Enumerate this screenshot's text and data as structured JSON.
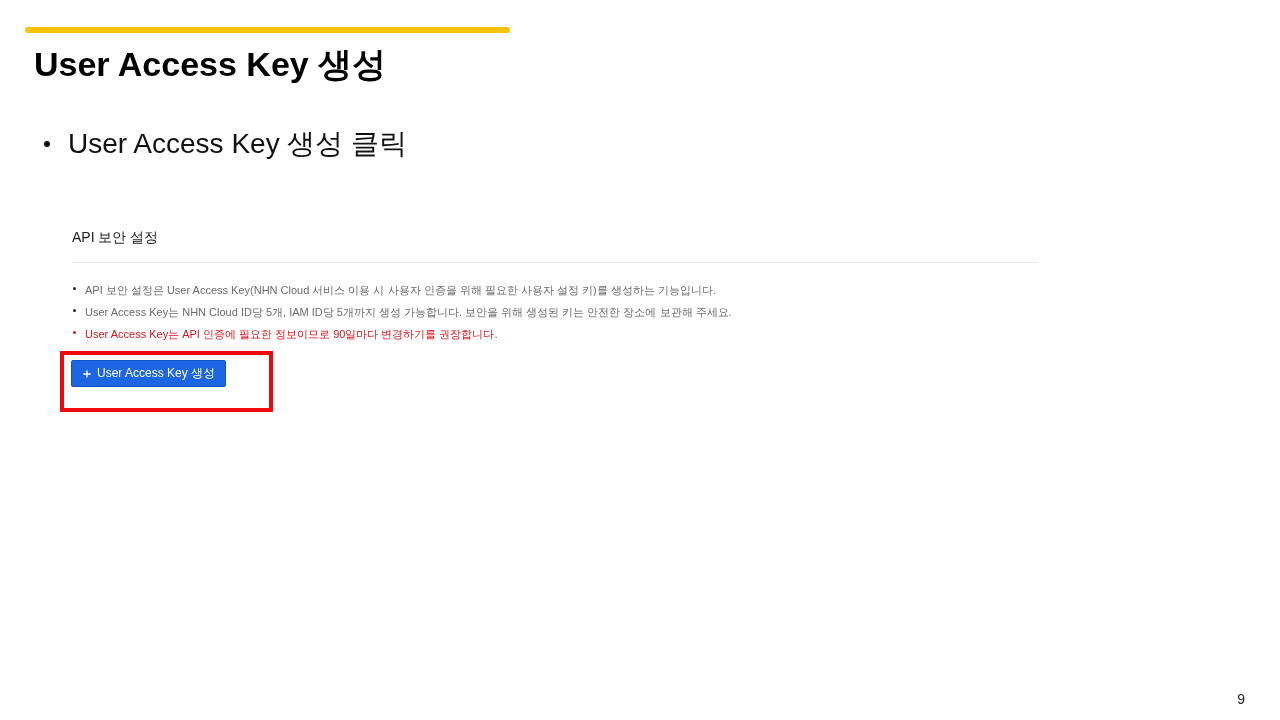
{
  "slide": {
    "title": "User Access Key 생성",
    "bullets": [
      "User Access Key 생성 클릭"
    ],
    "screenshot": {
      "heading": "API 보안 설정",
      "notes": [
        {
          "kind": "info",
          "text": "API 보안 설정은 User Access Key(NHN Cloud 서비스 이용 시 사용자 인증을 위해 필요한 사용자 설정 키)를 생성하는 기능입니다."
        },
        {
          "kind": "info",
          "text": "User Access Key는 NHN Cloud ID당 5개, IAM ID당 5개까지 생성 가능합니다. 보안을 위해 생성된 키는 안전한 장소에 보관해 주세요."
        },
        {
          "kind": "warning",
          "text": "User Access Key는 API 인증에 필요한 정보이므로 90일마다 변경하기를 권장합니다."
        }
      ],
      "button": {
        "label": "User Access Key 생성",
        "highlighted": true
      }
    },
    "page_number": "9"
  }
}
